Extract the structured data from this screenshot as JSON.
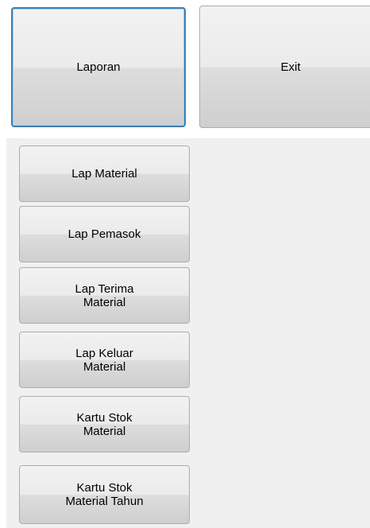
{
  "top_buttons": {
    "laporan_label": "Laporan",
    "exit_label": "Exit"
  },
  "report_menu": {
    "items": [
      {
        "label": "Lap Material"
      },
      {
        "label": "Lap Pemasok"
      },
      {
        "label": "Lap Terima\nMaterial"
      },
      {
        "label": "Lap Keluar\nMaterial"
      },
      {
        "label": "Kartu Stok\nMaterial"
      },
      {
        "label": "Kartu Stok\nMaterial Tahun"
      }
    ]
  },
  "colors": {
    "focus_border": "#3c7fb1",
    "panel_background": "#f0f0f0",
    "button_border": "#adadad"
  }
}
